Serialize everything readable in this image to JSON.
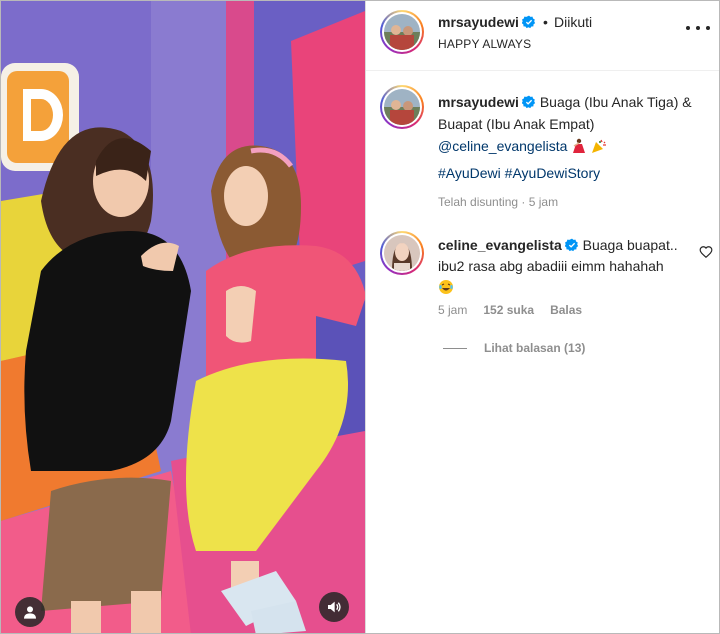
{
  "colors": {
    "link": "#00376b",
    "muted": "#8e8e8e",
    "verified": "#0095f6",
    "text": "#262626"
  },
  "media": {
    "user_tag_icon": "user-icon",
    "audio_icon": "speaker-icon"
  },
  "header": {
    "username": "mrsayudewi",
    "separator": "•",
    "follow_status": "Diikuti",
    "subtitle": "HAPPY ALWAYS",
    "more_icon": "more-options-icon"
  },
  "caption": {
    "username": "mrsayudewi",
    "text": "Buaga (Ibu Anak Tiga) & Buapat (Ibu Anak Empat)",
    "mention": "@celine_evangelista",
    "emojis": [
      "dancing-woman-emoji",
      "party-popper-emoji"
    ],
    "hashtags": "#AyuDewi #AyuDewiStory",
    "edited_label": "Telah disunting",
    "meta_separator": "·",
    "time": "5 jam"
  },
  "comment": {
    "username": "celine_evangelista",
    "text": "Buaga buapat.. ibu2 rasa abg abadiii eimm hahahah",
    "emoji": "laughing-tears-emoji",
    "time": "5 jam",
    "likes": "152 suka",
    "reply_label": "Balas",
    "view_replies": "Lihat balasan (13)"
  }
}
